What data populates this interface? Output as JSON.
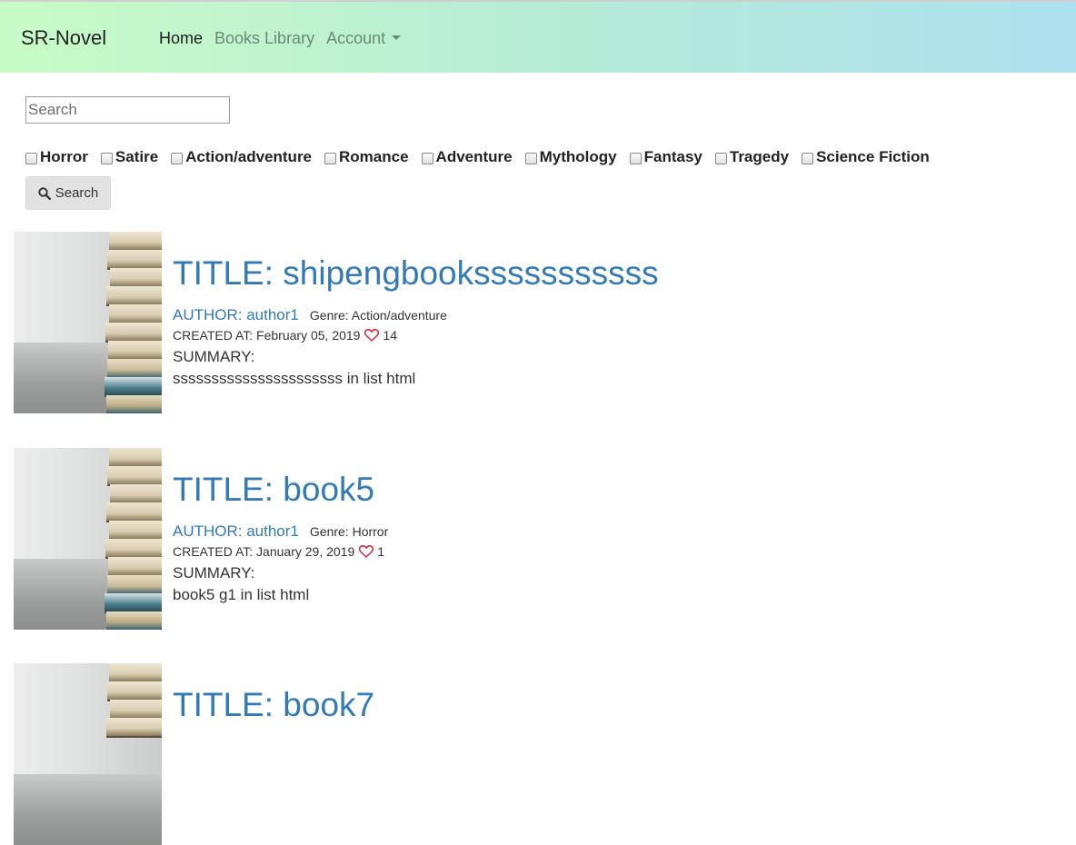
{
  "navbar": {
    "brand": "SR-Novel",
    "links": [
      {
        "label": "Home",
        "active": true
      },
      {
        "label": "Books Library",
        "active": false
      },
      {
        "label": "Account",
        "active": false,
        "dropdown": true
      }
    ],
    "gradient": [
      "#c8fcc7",
      "#aee0ef"
    ]
  },
  "search": {
    "placeholder": "Search",
    "value": "",
    "button_label": "Search",
    "button_icon": "search-icon"
  },
  "genres": [
    {
      "label": "Horror",
      "checked": false
    },
    {
      "label": "Satire",
      "checked": false
    },
    {
      "label": "Action/adventure",
      "checked": false
    },
    {
      "label": "Romance",
      "checked": false
    },
    {
      "label": "Adventure",
      "checked": false
    },
    {
      "label": "Mythology",
      "checked": false
    },
    {
      "label": "Fantasy",
      "checked": false
    },
    {
      "label": "Tragedy",
      "checked": false
    },
    {
      "label": "Science Fiction",
      "checked": false
    }
  ],
  "books": [
    {
      "title": "TITLE: shipengbooksssssssssss",
      "author": "AUTHOR: author1",
      "genre": "Genre: Action/adventure",
      "created": "CREATED AT: February 05, 2019",
      "likes": "14",
      "summary_label": "SUMMARY:",
      "summary": "ssssssssssssssssssssss in list html"
    },
    {
      "title": "TITLE: book5",
      "author": "AUTHOR: author1",
      "genre": "Genre: Horror",
      "created": "CREATED AT: January 29, 2019",
      "likes": "1",
      "summary_label": "SUMMARY:",
      "summary": "book5 g1 in list html"
    },
    {
      "title": "TITLE: book7"
    }
  ],
  "colors": {
    "link": "#337ab7",
    "heart": "#d9263a"
  }
}
